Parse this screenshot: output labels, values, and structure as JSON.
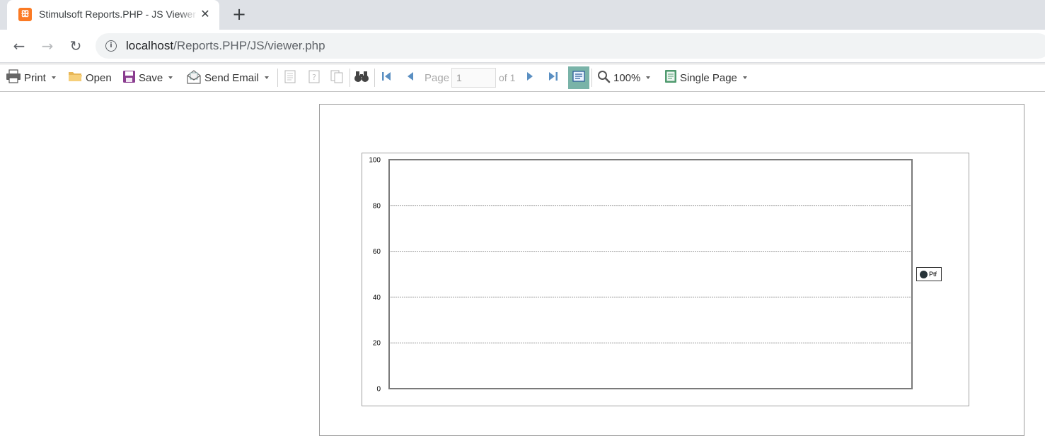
{
  "browser": {
    "tab_title": "Stimulsoft Reports.PHP - JS Viewer",
    "favicon": "xampp-icon",
    "url_host": "localhost",
    "url_path": "/Reports.PHP/JS/viewer.php"
  },
  "toolbar": {
    "print": "Print",
    "open": "Open",
    "save": "Save",
    "send_email": "Send Email",
    "page_label": "Page",
    "page_value": "1",
    "page_of": "of 1",
    "zoom": "100%",
    "view_mode": "Single Page"
  },
  "colors": {
    "toolbar_icon_blue": "#5a8fc2",
    "save_purple": "#8a3c8f",
    "view_toggle_bg": "#79b3a8",
    "legend_dot": "#273339"
  },
  "chart_data": {
    "type": "line",
    "y_ticks": [
      "100",
      "80",
      "60",
      "40",
      "20",
      "0"
    ],
    "ylim": [
      0,
      100
    ],
    "grid": true,
    "legend_position": "right",
    "series": [
      {
        "name": "Ptf",
        "values": []
      }
    ]
  }
}
